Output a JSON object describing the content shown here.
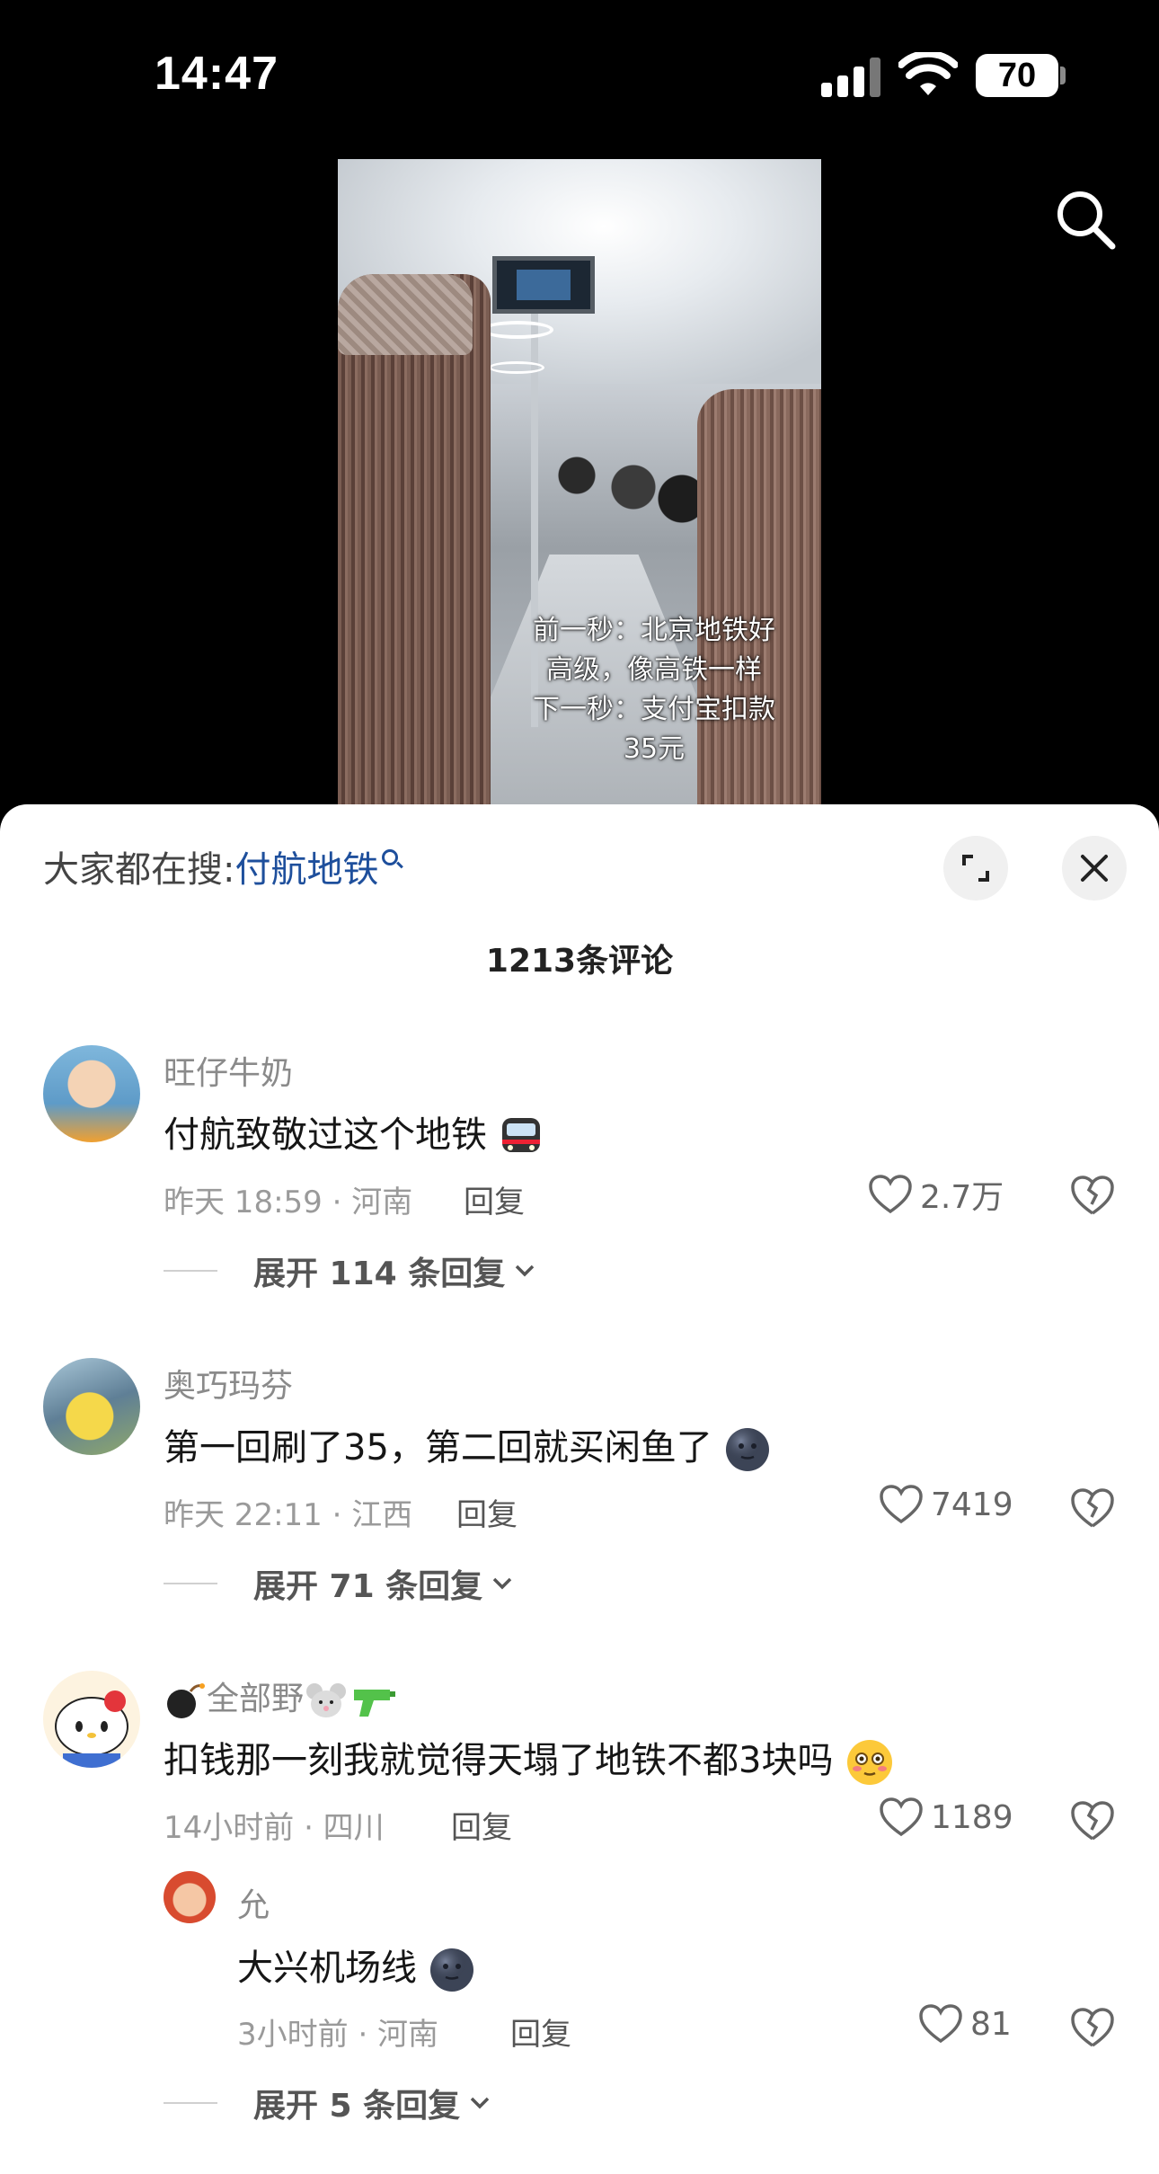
{
  "status_bar": {
    "time": "14:47",
    "battery": "70"
  },
  "video": {
    "caption_lines": [
      "前一秒：北京地铁好",
      "高级，像高铁一样",
      "下一秒：支付宝扣款",
      "35元"
    ]
  },
  "sheet": {
    "hot_search_prefix": "大家都在搜:",
    "hot_search_term": "付航地铁",
    "comment_count": "1213条评论"
  },
  "comments": [
    {
      "user": "旺仔牛奶",
      "text": "付航致敬过这个地铁",
      "emoji": "metro-emoji",
      "time_loc": "昨天 18:59 · 河南",
      "reply": "回复",
      "likes": "2.7万",
      "expand": "展开 114 条回复"
    },
    {
      "user": "奥巧玛芬",
      "text": "第一回刷了35，第二回就买闲鱼了",
      "emoji": "moon-face-emoji",
      "time_loc": "昨天 22:11 · 江西",
      "reply": "回复",
      "likes": "7419",
      "expand": "展开 71 条回复"
    },
    {
      "user": "全部野",
      "text": "扣钱那一刻我就觉得天塌了地铁不都3块吗",
      "emoji": "flushed-face-emoji",
      "time_loc": "14小时前 · 四川",
      "reply": "回复",
      "likes": "1189"
    }
  ],
  "sub_reply": {
    "user": "允",
    "text": "大兴机场线",
    "emoji": "moon-face-emoji",
    "time_loc": "3小时前 · 河南",
    "reply": "回复",
    "likes": "81",
    "expand": "展开 5 条回复"
  }
}
